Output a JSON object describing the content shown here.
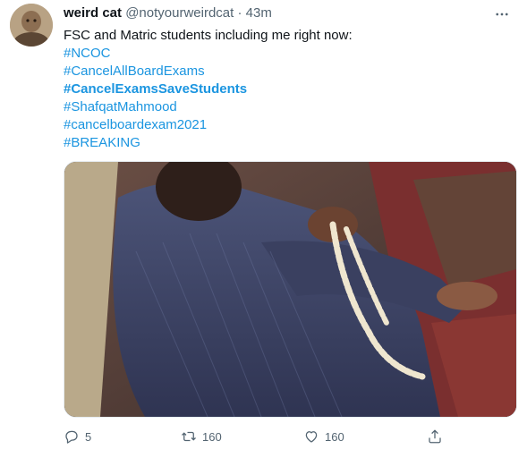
{
  "tweet": {
    "author_name": "weird cat",
    "handle": "@notyourweirdcat",
    "separator": "·",
    "time": "43m",
    "text_lines": [
      {
        "text": "FSC and Matric students including me right now:",
        "type": "plain"
      },
      {
        "text": "#NCOC",
        "type": "hashtag"
      },
      {
        "text": "#CancelAllBoardExams",
        "type": "hashtag"
      },
      {
        "text": "#CancelExamsSaveStudents",
        "type": "hashtag-bold"
      },
      {
        "text": "#ShafqatMahmood",
        "type": "hashtag"
      },
      {
        "text": "#cancelboardexam2021",
        "type": "hashtag"
      },
      {
        "text": "#BREAKING",
        "type": "hashtag"
      }
    ],
    "actions": {
      "reply_count": "5",
      "retweet_count": "160",
      "like_count": "160"
    }
  },
  "colors": {
    "accent": "#1b95e0",
    "secondary_text": "#536471"
  },
  "icons": {
    "reply": "reply-icon",
    "retweet": "retweet-icon",
    "like": "heart-icon",
    "share": "share-icon",
    "more": "more-icon"
  }
}
